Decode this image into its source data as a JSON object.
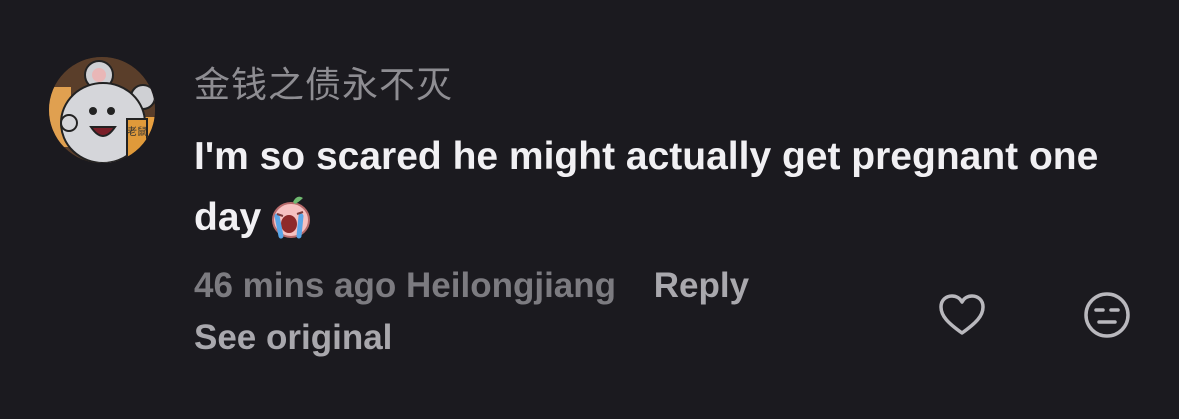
{
  "comment": {
    "username": "金钱之债永不灭",
    "text": "I'm so scared he might actually get pregnant one day",
    "emoji": "crying-face-emoji",
    "avatar_text": "老鼠",
    "timestamp": "46 mins ago",
    "location": "Heilongjiang",
    "reply_label": "Reply",
    "see_original_label": "See original"
  },
  "icons": {
    "like": "heart-outline-icon",
    "dislike": "unamused-face-icon"
  },
  "colors": {
    "background": "#1b1a1f",
    "primary_text": "#f1f0f3",
    "secondary_text": "#7c7b80",
    "action_text": "#a9a8ad"
  }
}
